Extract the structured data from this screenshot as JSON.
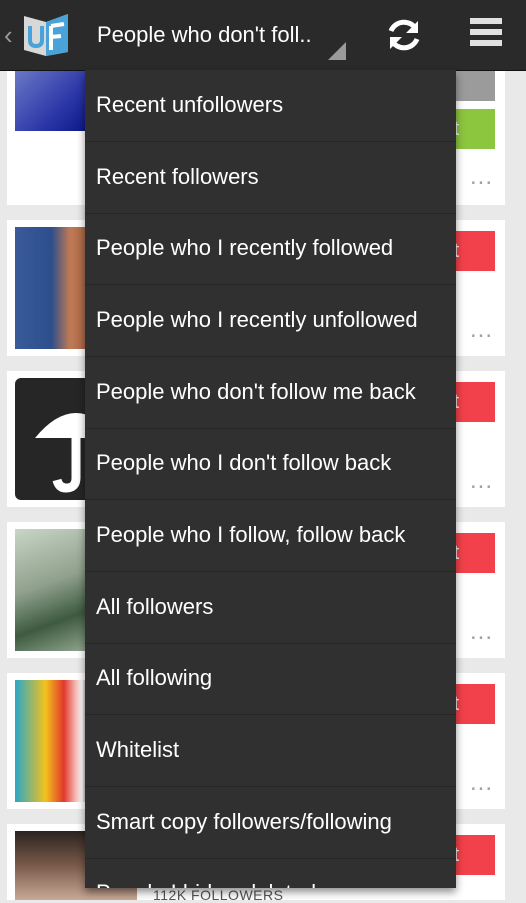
{
  "actionbar": {
    "logo_text": "UF",
    "spinner_label": "People who don't foll..",
    "refresh_icon": "refresh-icon",
    "menu_icon": "overflow-menu-icon"
  },
  "dropdown": {
    "items": [
      "Recent unfollowers",
      "Recent followers",
      "People who I recently followed",
      "People who I recently unfollowed",
      "People who don't follow me back",
      "People who I don't follow back",
      "People who I follow, follow back",
      "All followers",
      "All following",
      "Whitelist",
      "Smart copy followers/following",
      "People I hid or deleted"
    ]
  },
  "list": {
    "pill_labels": [
      "ist",
      "ist",
      "ist",
      "ist",
      "ist",
      "ist"
    ],
    "more_label": "...",
    "last_followers": "112K FOLLOWERS"
  },
  "colors": {
    "actionbar": "#2a2a2a",
    "dropdown": "#303030",
    "whitelist_green": "#8cc63f",
    "whitelist_red": "#f2414a",
    "logo_blue": "#4aa3d8"
  }
}
